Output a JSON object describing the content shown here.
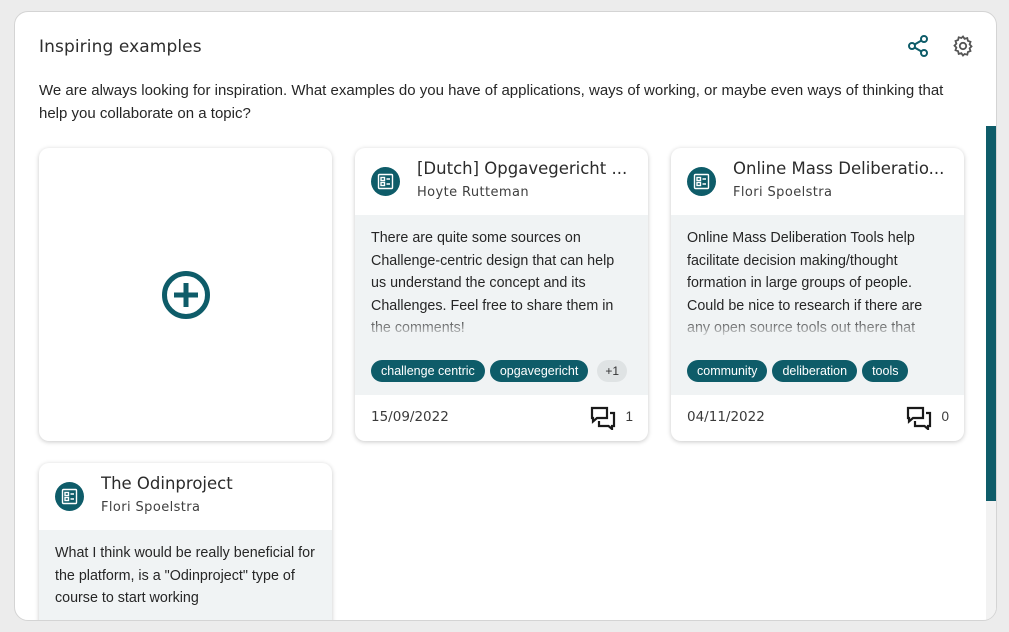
{
  "panel": {
    "title": "Inspiring examples",
    "description": "We are always looking for inspiration. What examples do you have of applications, ways of working, or maybe even ways of thinking that help you collaborate on a topic?",
    "icons": {
      "share": "share-icon",
      "settings": "gear-icon",
      "add": "add-circle-icon"
    }
  },
  "cards": [
    {
      "title": "[Dutch] Opgavegericht ...",
      "author": "Hoyte Rutteman",
      "text": "There are quite some sources on Challenge-centric design that can help us understand the concept and its Challenges. Feel free to share them in the comments!",
      "tags": [
        "challenge centric",
        "opgavegericht"
      ],
      "more_tags": "+1",
      "date": "15/09/2022",
      "comments": "1"
    },
    {
      "title": "Online Mass Deliberatio...",
      "author": "Flori Spoelstra",
      "text": "Online Mass Deliberation Tools help facilitate decision making/thought formation in large groups of people. Could be nice to research if there are any open source tools out there that",
      "tags": [
        "community",
        "deliberation",
        "tools"
      ],
      "date": "04/11/2022",
      "comments": "0"
    },
    {
      "title": "The Odinproject",
      "author": "Flori Spoelstra",
      "text": "What I think would be really beneficial for the platform, is a \"Odinproject\" type of course to start working"
    }
  ],
  "colors": {
    "accent": "#0e5c69",
    "card_body": "#f0f3f4",
    "panel_bg": "#ffffff"
  }
}
